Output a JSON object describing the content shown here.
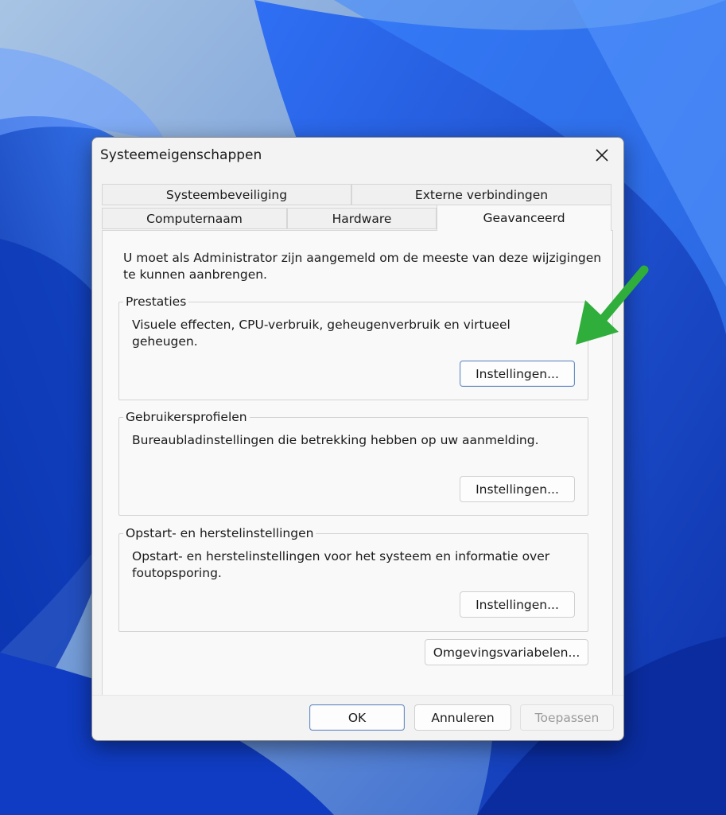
{
  "colors": {
    "arrow": "#2fae3b",
    "primary_button_border": "#6a8fc4",
    "wallpaper_blue": "#1248d8"
  },
  "dialog": {
    "title": "Systeemeigenschappen",
    "close_icon": "close-icon",
    "tabs_row1": [
      "Systeembeveiliging",
      "Externe verbindingen"
    ],
    "tabs_row2": [
      "Computernaam",
      "Hardware",
      "Geavanceerd"
    ],
    "active_tab": "Geavanceerd",
    "intro": "U moet als Administrator zijn aangemeld om de meeste van deze wijzigingen te kunnen aanbrengen.",
    "groups": {
      "performance": {
        "title": "Prestaties",
        "description": "Visuele effecten, CPU-verbruik, geheugenverbruik en virtueel geheugen.",
        "button": "Instellingen..."
      },
      "profiles": {
        "title": "Gebruikersprofielen",
        "description": "Bureaubladinstellingen die betrekking hebben op uw aanmelding.",
        "button": "Instellingen..."
      },
      "startup": {
        "title": "Opstart- en herstelinstellingen",
        "description": "Opstart- en herstelinstellingen voor het systeem en informatie over foutopsporing.",
        "button": "Instellingen..."
      }
    },
    "env_button": "Omgevingsvariabelen...",
    "footer": {
      "ok": "OK",
      "cancel": "Annuleren",
      "apply": "Toepassen"
    }
  },
  "annotation": {
    "icon": "arrow-icon"
  }
}
